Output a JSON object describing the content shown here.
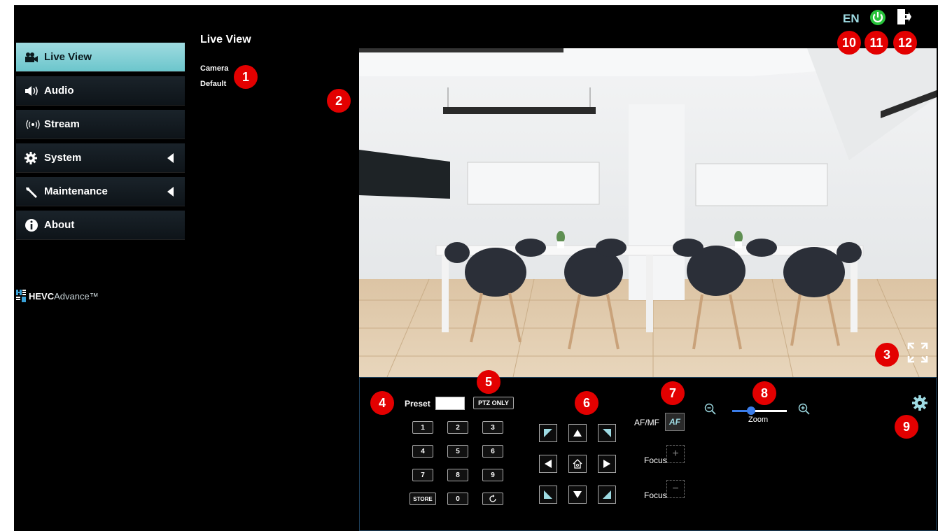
{
  "header": {
    "lang": "EN"
  },
  "sidebar": {
    "items": [
      {
        "label": "Live View",
        "icon": "video-camera-icon",
        "active": true
      },
      {
        "label": "Audio",
        "icon": "speaker-icon"
      },
      {
        "label": "Stream",
        "icon": "broadcast-icon"
      },
      {
        "label": "System",
        "icon": "gear-icon",
        "expandable": true
      },
      {
        "label": "Maintenance",
        "icon": "wrench-icon",
        "expandable": true
      },
      {
        "label": "About",
        "icon": "info-icon"
      }
    ],
    "logo": {
      "brand": "HEVC",
      "suffix": "Advance™"
    }
  },
  "page": {
    "title": "Live View",
    "links": [
      "Camera",
      "Default"
    ]
  },
  "badges": [
    "1",
    "2",
    "3",
    "4",
    "5",
    "6",
    "7",
    "8",
    "9",
    "10",
    "11",
    "12"
  ],
  "controls": {
    "preset_label": "Preset",
    "ptz_only": "PTZ ONLY",
    "keypad": [
      "1",
      "2",
      "3",
      "4",
      "5",
      "6",
      "7",
      "8",
      "9",
      "STORE",
      "0",
      ""
    ],
    "af_mf_label": "AF/MF",
    "af_button": "AF",
    "focus_label": "Focus",
    "zoom_label": "Zoom",
    "zoom_level": 0.35
  },
  "colors": {
    "accent": "#6cc6cc",
    "badge": "#e30000",
    "power": "#27c23a"
  }
}
